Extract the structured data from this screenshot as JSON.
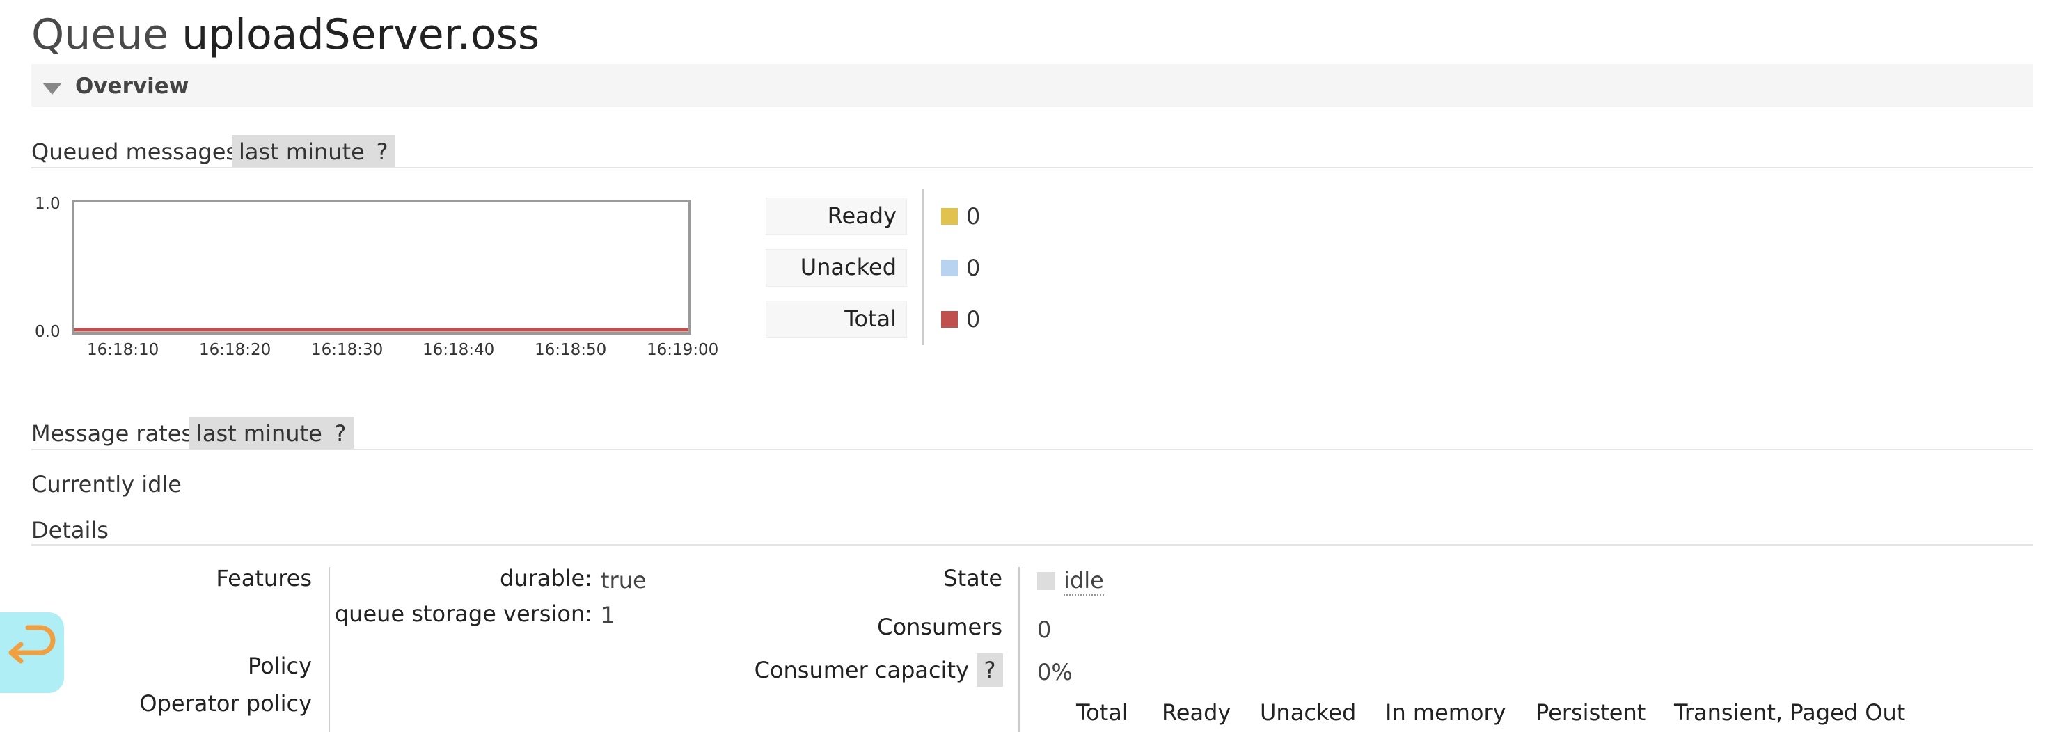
{
  "page": {
    "title_prefix": "Queue",
    "queue_name": "uploadServer.oss"
  },
  "overview": {
    "section_label": "Overview"
  },
  "queued_messages": {
    "label": "Queued messages",
    "range": "last minute",
    "help": "?"
  },
  "chart_data": {
    "type": "area",
    "title": "",
    "x": [
      "16:18:10",
      "16:18:20",
      "16:18:30",
      "16:18:40",
      "16:18:50",
      "16:19:00"
    ],
    "y_ticks": [
      "1.0",
      "0.0"
    ],
    "ylim": [
      0,
      1
    ],
    "grid": false,
    "legend": "right",
    "series": [
      {
        "name": "Ready",
        "values": [
          0,
          0,
          0,
          0,
          0,
          0
        ],
        "color": "#e2c24e"
      },
      {
        "name": "Unacked",
        "values": [
          0,
          0,
          0,
          0,
          0,
          0
        ],
        "color": "#b8d3f0"
      },
      {
        "name": "Total",
        "values": [
          0,
          0,
          0,
          0,
          0,
          0
        ],
        "color": "#c0504d"
      }
    ]
  },
  "legend": {
    "ready_label": "Ready",
    "ready_value": "0",
    "unacked_label": "Unacked",
    "unacked_value": "0",
    "total_label": "Total",
    "total_value": "0"
  },
  "message_rates": {
    "label": "Message rates",
    "range": "last minute",
    "help": "?",
    "idle_text": "Currently idle"
  },
  "details": {
    "label": "Details",
    "features_label": "Features",
    "durable_label": "durable:",
    "durable_value": "true",
    "storage_label": "queue storage version:",
    "storage_value": "1",
    "policy_label": "Policy",
    "operator_policy_label": "Operator policy",
    "state_label": "State",
    "state_value": "idle",
    "consumers_label": "Consumers",
    "consumers_value": "0",
    "capacity_label": "Consumer capacity",
    "capacity_help": "?",
    "capacity_value": "0%",
    "columns": [
      "Total",
      "Ready",
      "Unacked",
      "In memory",
      "Persistent",
      "Transient, Paged Out"
    ]
  },
  "colors": {
    "back_button": "#aeeef4",
    "back_arrow": "#f0a040",
    "state_indicator": "#dddddd"
  }
}
